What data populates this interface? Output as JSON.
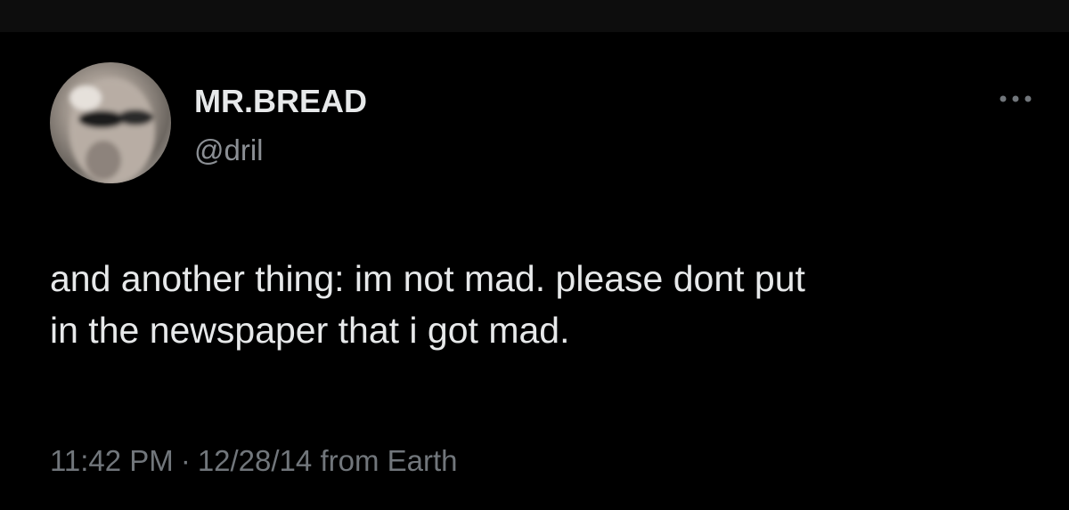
{
  "tweet": {
    "author": {
      "display_name": "MR.BREAD",
      "handle": "@dril"
    },
    "text": "and another thing: im not mad. please dont put\nin the newspaper that i got mad.",
    "time": "11:42 PM",
    "separator": "·",
    "date": "12/28/14",
    "source": "from Earth",
    "more_icon": "more-horizontal-icon"
  },
  "colors": {
    "background": "#000000",
    "primary_text": "#e7e9ea",
    "secondary_text": "#71767b"
  }
}
